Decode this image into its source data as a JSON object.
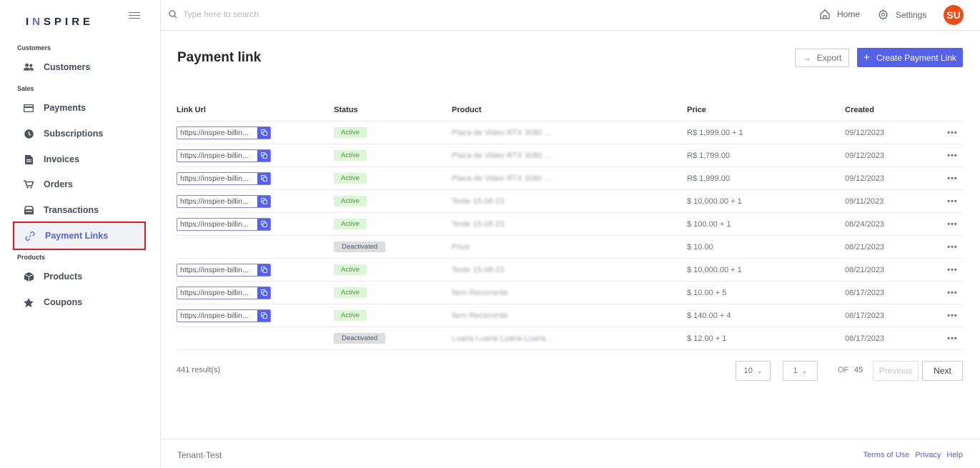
{
  "brand": {
    "name_pre": "I",
    "name_n": "N",
    "name_post": "SPIRE"
  },
  "search": {
    "placeholder": "Type here to search"
  },
  "topnav": {
    "home": "Home",
    "settings": "Settings",
    "avatar": "SU"
  },
  "sidebar": {
    "sections": [
      "Customers",
      "Sales",
      "Products"
    ],
    "items": [
      {
        "label": "Customers",
        "icon": "users-icon"
      },
      {
        "label": "Payments",
        "icon": "card-icon"
      },
      {
        "label": "Subscriptions",
        "icon": "clock-icon"
      },
      {
        "label": "Invoices",
        "icon": "document-icon"
      },
      {
        "label": "Orders",
        "icon": "cart-icon"
      },
      {
        "label": "Transactions",
        "icon": "wallet-icon"
      },
      {
        "label": "Payment Links",
        "icon": "link-icon",
        "active": true
      },
      {
        "label": "Products",
        "icon": "box-icon"
      },
      {
        "label": "Coupons",
        "icon": "star-icon"
      }
    ]
  },
  "page": {
    "title": "Payment link",
    "export_label": "Export",
    "create_label": "Create Payment Link"
  },
  "table": {
    "headers": [
      "Link Url",
      "Status",
      "Product",
      "Price",
      "Created"
    ],
    "rows": [
      {
        "url": "https://inspire-billin...",
        "status": "Active",
        "product": "Placa de Video RTX 3080 ...",
        "price": "R$ 1,999.00 + 1",
        "created": "09/12/2023"
      },
      {
        "url": "https://inspire-billin...",
        "status": "Active",
        "product": "Placa de Video RTX 3080 ...",
        "price": "R$ 1,799.00",
        "created": "09/12/2023"
      },
      {
        "url": "https://inspire-billin...",
        "status": "Active",
        "product": "Placa de Video RTX 3080 ...",
        "price": "R$ 1,999.00",
        "created": "09/12/2023"
      },
      {
        "url": "https://inspire-billin...",
        "status": "Active",
        "product": "Teste 15-08-23",
        "price": "$ 10,000.00 + 1",
        "created": "09/11/2023"
      },
      {
        "url": "https://inspire-billin...",
        "status": "Active",
        "product": "Teste 15-08-23",
        "price": "$ 100.00 + 1",
        "created": "08/24/2023"
      },
      {
        "url": "",
        "status": "Deactivated",
        "product": "Price",
        "price": "$ 10.00",
        "created": "08/21/2023"
      },
      {
        "url": "https://inspire-billin...",
        "status": "Active",
        "product": "Teste 15-08-23",
        "price": "$ 10,000.00 + 1",
        "created": "08/21/2023"
      },
      {
        "url": "https://inspire-billin...",
        "status": "Active",
        "product": "Item Recorrente",
        "price": "$ 10.00 + 5",
        "created": "08/17/2023"
      },
      {
        "url": "https://inspire-billin...",
        "status": "Active",
        "product": "Item Recorrente",
        "price": "$ 140.00 + 4",
        "created": "08/17/2023"
      },
      {
        "url": "",
        "status": "Deactivated",
        "product": "Luana Luana Luana Luana...",
        "price": "$ 12.00 + 1",
        "created": "08/17/2023"
      }
    ],
    "row_menu": "•••"
  },
  "pagination": {
    "results": "441 result(s)",
    "page_size": "10",
    "page": "1",
    "of_label": "OF",
    "total_pages": "45",
    "prev_label": "Previous",
    "next_label": "Next"
  },
  "footer": {
    "tenant": "Tenant-Test",
    "links": [
      "Terms of Use",
      "Privacy",
      "Help"
    ]
  },
  "colors": {
    "accent": "#5561e8",
    "avatar": "#f04a15",
    "active_badge_bg": "#dcf5d6",
    "highlight_border": "#e01b1b"
  }
}
